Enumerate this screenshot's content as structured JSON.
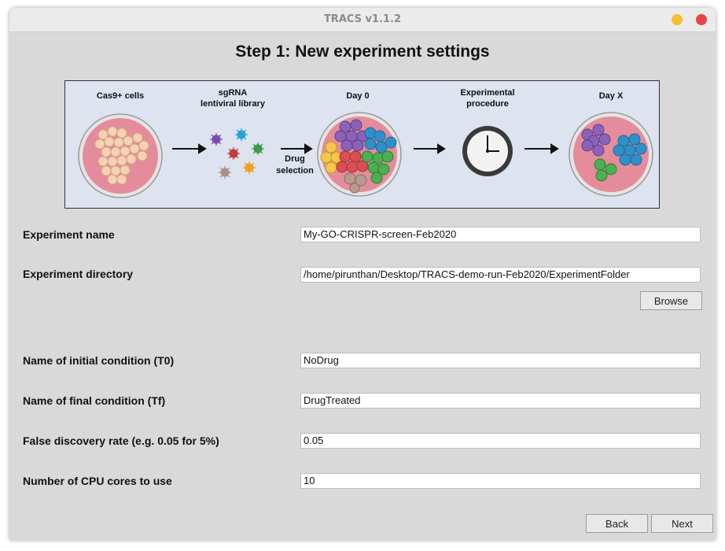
{
  "window": {
    "title": "TRACS v1.1.2"
  },
  "heading": "Step 1: New experiment settings",
  "diagram": {
    "cas9_label": "Cas9+ cells",
    "sgrna_label_1": "sgRNA",
    "sgrna_label_2": "lentiviral library",
    "drug_label_1": "Drug",
    "drug_label_2": "selection",
    "day0_label": "Day 0",
    "procedure_label_1": "Experimental",
    "procedure_label_2": "procedure",
    "dayx_label": "Day X"
  },
  "form": {
    "experiment_name_label": "Experiment name",
    "experiment_name_value": "My-GO-CRISPR-screen-Feb2020",
    "experiment_directory_label": "Experiment directory",
    "experiment_directory_value": "/home/pirunthan/Desktop/TRACS-demo-run-Feb2020/ExperimentFolder",
    "browse_label": "Browse",
    "initial_condition_label": "Name of initial condition (T0)",
    "initial_condition_value": "NoDrug",
    "final_condition_label": "Name of final condition (Tf)",
    "final_condition_value": "DrugTreated",
    "fdr_label": "False discovery rate (e.g. 0.05 for 5%)",
    "fdr_value": "0.05",
    "cpu_label": "Number of CPU cores to use",
    "cpu_value": "10"
  },
  "nav": {
    "back_label": "Back",
    "next_label": "Next"
  },
  "colors": {
    "window_bg": "#d9d9d9",
    "titlebar_bg": "#ebebeb",
    "minimize": "#f5c02e",
    "close": "#ea4545"
  }
}
